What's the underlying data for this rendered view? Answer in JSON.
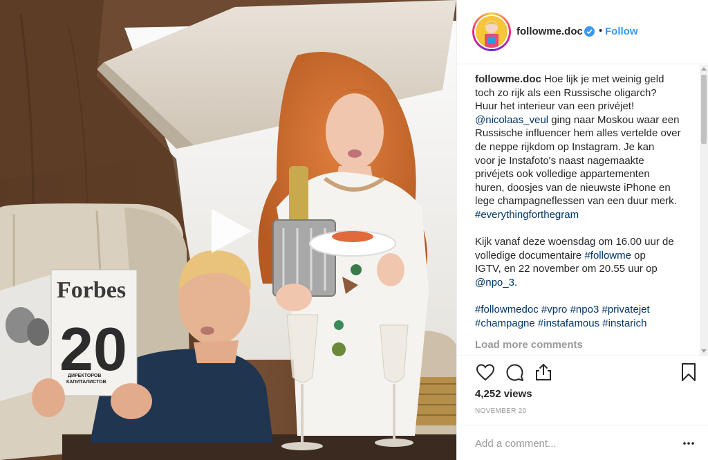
{
  "post": {
    "username": "followme.doc",
    "follow_label": "Follow",
    "separator": "•",
    "magazine": {
      "title": "Forbes",
      "number": "20",
      "subtitle_1": "ДИРЕКТОРОВ",
      "subtitle_2": "КАПИТАЛИСТОВ"
    },
    "caption": {
      "author": "followme.doc",
      "lines": [
        " Hoe lijk je met weinig geld",
        "toch zo rijk als een Russische oligarch?",
        "Huur het interieur van een privéjet!",
        "",
        "Russische influencer hem alles vertelde over",
        "de neppe rijkdom op Instagram. Je kan",
        "voor je Instafoto's naast nagemaakte",
        "privéjets ook volledige appartementen",
        "huren, doosjes van de nieuwste iPhone en",
        "lege champagneflessen van een duur merk."
      ],
      "mention_1": "@nicolaas_veul",
      "mention_1_rest": " ging naar Moskou waar een",
      "hashtag_1": "#everythingforthegram",
      "para2_line1": "Kijk vanaf deze woensdag om 16.00 uur de",
      "para2_line2_pre": "volledige documentaire ",
      "para2_line2_tag": "#followme",
      "para2_line2_post": " op",
      "para2_line3": "IGTV, en 22 november om 20.55 uur op",
      "para2_mention": "@npo_3",
      "para2_end": ".",
      "tags_line1": "#followmedoc #vpro #npo3 #privatejet",
      "tags_line2": "#champagne #instafamous #instarich"
    },
    "load_more": "Load more comments",
    "views": "4,252 views",
    "date": "NOVEMBER 20",
    "comment_placeholder": "Add a comment..."
  }
}
